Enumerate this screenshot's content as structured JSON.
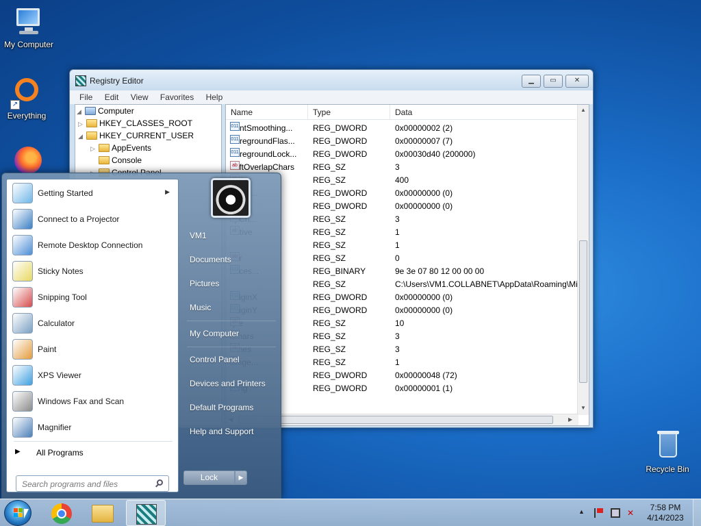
{
  "desktop": {
    "icons": [
      {
        "label": "My Computer",
        "icon": "my-computer-icon"
      },
      {
        "label": "Everything",
        "icon": "everything-icon"
      },
      {
        "label": "",
        "icon": "firefox-icon"
      },
      {
        "label": "Recycle Bin",
        "icon": "recycle-bin-icon"
      }
    ]
  },
  "window": {
    "title": "Registry Editor",
    "menu": [
      "File",
      "Edit",
      "View",
      "Favorites",
      "Help"
    ],
    "tree": [
      {
        "label": "Computer",
        "expanded": true
      },
      {
        "label": "HKEY_CLASSES_ROOT",
        "expanded": false
      },
      {
        "label": "HKEY_CURRENT_USER",
        "expanded": true
      },
      {
        "label": "AppEvents",
        "expanded": false
      },
      {
        "label": "Console",
        "expanded": false
      },
      {
        "label": "Control Panel",
        "expanded": false
      }
    ],
    "columns": [
      "Name",
      "Type",
      "Data"
    ],
    "values": [
      {
        "name": "FontSmoothing...",
        "type": "REG_DWORD",
        "data": "0x00000002 (2)",
        "kind": "bin"
      },
      {
        "name": "ForegroundFlas...",
        "type": "REG_DWORD",
        "data": "0x00000007 (7)",
        "kind": "bin"
      },
      {
        "name": "ForegroundLock...",
        "type": "REG_DWORD",
        "data": "0x00030d40 (200000)",
        "kind": "bin"
      },
      {
        "name": "LeftOverlapChars",
        "type": "REG_SZ",
        "data": "3",
        "kind": "sz"
      },
      {
        "name": "Delay",
        "type": "REG_SZ",
        "data": "400",
        "kind": "sz"
      },
      {
        "name": "ppVer...",
        "type": "REG_DWORD",
        "data": "0x00000000 (0)",
        "kind": "bin"
      },
      {
        "name": "",
        "type": "REG_DWORD",
        "data": "0x00000000 (0)",
        "kind": "bin"
      },
      {
        "name": "apCh...",
        "type": "REG_SZ",
        "data": "3",
        "kind": "sz"
      },
      {
        "name": "Active",
        "type": "REG_SZ",
        "data": "1",
        "kind": "sz"
      },
      {
        "name": "",
        "type": "REG_SZ",
        "data": "1",
        "kind": "sz"
      },
      {
        "name": "ber",
        "type": "REG_SZ",
        "data": "0",
        "kind": "sz"
      },
      {
        "name": "ences...",
        "type": "REG_BINARY",
        "data": "9e 3e 07 80 12 00 00 00",
        "kind": "bin"
      },
      {
        "name": "",
        "type": "REG_SZ",
        "data": "C:\\Users\\VM1.COLLABNET\\AppData\\Roaming\\Mi",
        "kind": "sz"
      },
      {
        "name": "OriginX",
        "type": "REG_DWORD",
        "data": "0x00000000 (0)",
        "kind": "bin"
      },
      {
        "name": "OriginY",
        "type": "REG_DWORD",
        "data": "0x00000000 (0)",
        "kind": "bin"
      },
      {
        "name": "tyle",
        "type": "REG_SZ",
        "data": "10",
        "kind": "sz"
      },
      {
        "name": "lChars",
        "type": "REG_SZ",
        "data": "3",
        "kind": "sz"
      },
      {
        "name": "lLines",
        "type": "REG_SZ",
        "data": "3",
        "kind": "sz"
      },
      {
        "name": "range...",
        "type": "REG_SZ",
        "data": "1",
        "kind": "sz"
      },
      {
        "name": "",
        "type": "REG_DWORD",
        "data": "0x00000048 (72)",
        "kind": "bin"
      },
      {
        "name": "aling",
        "type": "REG_DWORD",
        "data": "0x00000001 (1)",
        "kind": "bin"
      }
    ]
  },
  "start_menu": {
    "programs": [
      {
        "label": "Getting Started",
        "icon": "getting-started-icon",
        "has_submenu": true
      },
      {
        "label": "Connect to a Projector",
        "icon": "projector-icon",
        "has_submenu": false
      },
      {
        "label": "Remote Desktop Connection",
        "icon": "remote-desktop-icon",
        "has_submenu": false
      },
      {
        "label": "Sticky Notes",
        "icon": "sticky-notes-icon",
        "has_submenu": false
      },
      {
        "label": "Snipping Tool",
        "icon": "snipping-tool-icon",
        "has_submenu": false
      },
      {
        "label": "Calculator",
        "icon": "calculator-icon",
        "has_submenu": false
      },
      {
        "label": "Paint",
        "icon": "paint-icon",
        "has_submenu": false
      },
      {
        "label": "XPS Viewer",
        "icon": "xps-viewer-icon",
        "has_submenu": false
      },
      {
        "label": "Windows Fax and Scan",
        "icon": "fax-scan-icon",
        "has_submenu": false
      },
      {
        "label": "Magnifier",
        "icon": "magnifier-icon",
        "has_submenu": false
      }
    ],
    "all_programs": "All Programs",
    "search_placeholder": "Search programs and files",
    "right_items": [
      "VM1",
      "Documents",
      "Pictures",
      "Music",
      "My Computer",
      "Control Panel",
      "Devices and Printers",
      "Default Programs",
      "Help and Support"
    ],
    "lock_label": "Lock"
  },
  "taskbar": {
    "pinned": [
      "chrome-icon",
      "windows-explorer-icon",
      "registry-editor-icon"
    ],
    "clock_time": "7:58 PM",
    "clock_date": "4/14/2023"
  },
  "colors": {
    "desktop": "#1a6cc6",
    "accent": "#2f8de0"
  }
}
